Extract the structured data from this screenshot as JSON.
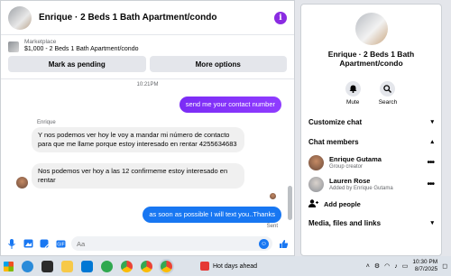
{
  "chat": {
    "title": "Enrique · 2 Beds 1 Bath Apartment/condo",
    "marketplace_label": "Marketplace",
    "listing_detail": "$1,000 - 2 Beds 1 Bath Apartment/condo",
    "mark_pending_label": "Mark as pending",
    "more_options_label": "More options",
    "timestamp": "10:21PM",
    "sender_name": "Enrique",
    "messages": [
      {
        "text": "send me your contact number"
      },
      {
        "text": "Y nos podemos ver hoy le voy a mandar mi número de contacto para que me llame porque estoy interesado en rentar 4255634683"
      },
      {
        "text": "Nos podemos ver hoy a las 12 confirmeme estoy interesado en rentar"
      },
      {
        "text": "as soon as possible I will text you..Thanks"
      }
    ],
    "sent_label": "Sent",
    "input_placeholder": "Aa"
  },
  "side": {
    "title": "Enrique · 2 Beds 1 Bath Apartment/condo",
    "mute_label": "Mute",
    "search_label": "Search",
    "customize_label": "Customize chat",
    "members_label": "Chat members",
    "members": [
      {
        "name": "Enrique Gutama",
        "role": "Group creator"
      },
      {
        "name": "Lauren Rose",
        "role": "Added by Enrique Gutama"
      }
    ],
    "add_people_label": "Add people",
    "media_label": "Media, files and links"
  },
  "taskbar": {
    "weather_text": "Hot days ahead",
    "time": "10:30 PM",
    "date": "8/7/2025"
  },
  "colors": {
    "accent_purple": "#8b2cf5",
    "accent_blue": "#1877f2"
  }
}
